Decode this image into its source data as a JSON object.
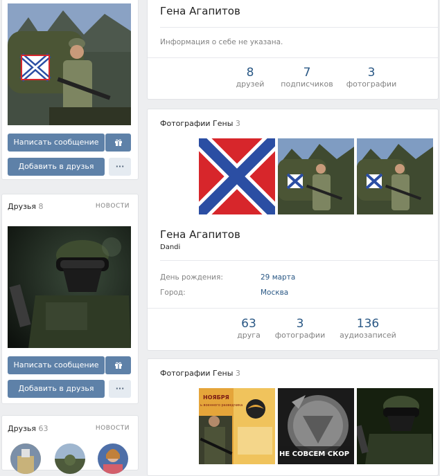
{
  "left_top": {
    "write_message": "Написать сообщение",
    "add_friend": "Добавить в друзья",
    "more": "···"
  },
  "friends1": {
    "title": "Друзья",
    "count": "8",
    "news": "НОВОСТИ"
  },
  "left_mid": {
    "write_message": "Написать сообщение",
    "add_friend": "Добавить в друзья",
    "more": "···"
  },
  "friends2": {
    "title": "Друзья",
    "count": "63",
    "news": "НОВОСТИ"
  },
  "profile1": {
    "name": "Гена Агапитов",
    "about": "Информация о себе не указана.",
    "counts": [
      {
        "value": "8",
        "label": "друзей"
      },
      {
        "value": "7",
        "label": "подписчиков"
      },
      {
        "value": "3",
        "label": "фотографии"
      }
    ],
    "photos_title": "Фотографии Гены",
    "photos_count": "3"
  },
  "profile2": {
    "name": "Гена Агапитов",
    "nickname": "Dandi",
    "birthday_label": "День рождения:",
    "birthday_value": "29 марта",
    "city_label": "Город:",
    "city_value": "Москва",
    "counts": [
      {
        "value": "63",
        "label": "друга"
      },
      {
        "value": "3",
        "label": "фотографии"
      },
      {
        "value": "136",
        "label": "аудиозаписей"
      }
    ],
    "photos_title": "Фотографии Гены",
    "photos_count": "3"
  },
  "poster_text": {
    "month": "НОЯБРЯ",
    "line": "ь военного разведчика",
    "medal": "НЕ СОВСЕМ СКОР"
  },
  "colors": {
    "accent": "#5e81a8",
    "link": "#2a5885",
    "flag_red": "#d7262b",
    "flag_blue": "#2b4ea3"
  }
}
